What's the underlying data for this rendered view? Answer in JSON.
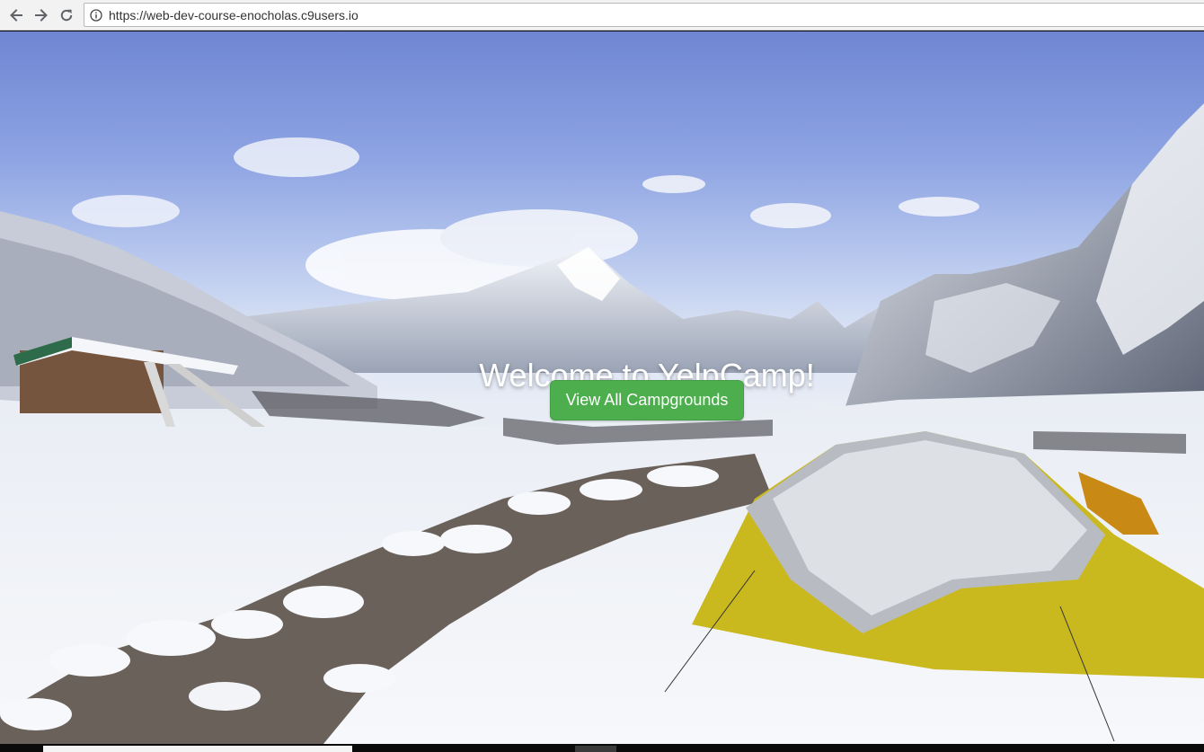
{
  "browser": {
    "url": "https://web-dev-course-enocholas.c9users.io",
    "icons": {
      "back": "arrow-left-icon",
      "forward": "arrow-right-icon",
      "reload": "reload-icon",
      "site_info": "info-icon"
    }
  },
  "landing": {
    "title": "Welcome to YelpCamp!",
    "button_label": "View All Campgrounds"
  },
  "colors": {
    "button_green": "#4cae4c",
    "title_text": "#ffffff",
    "tent_yellow": "#c9b81e"
  }
}
